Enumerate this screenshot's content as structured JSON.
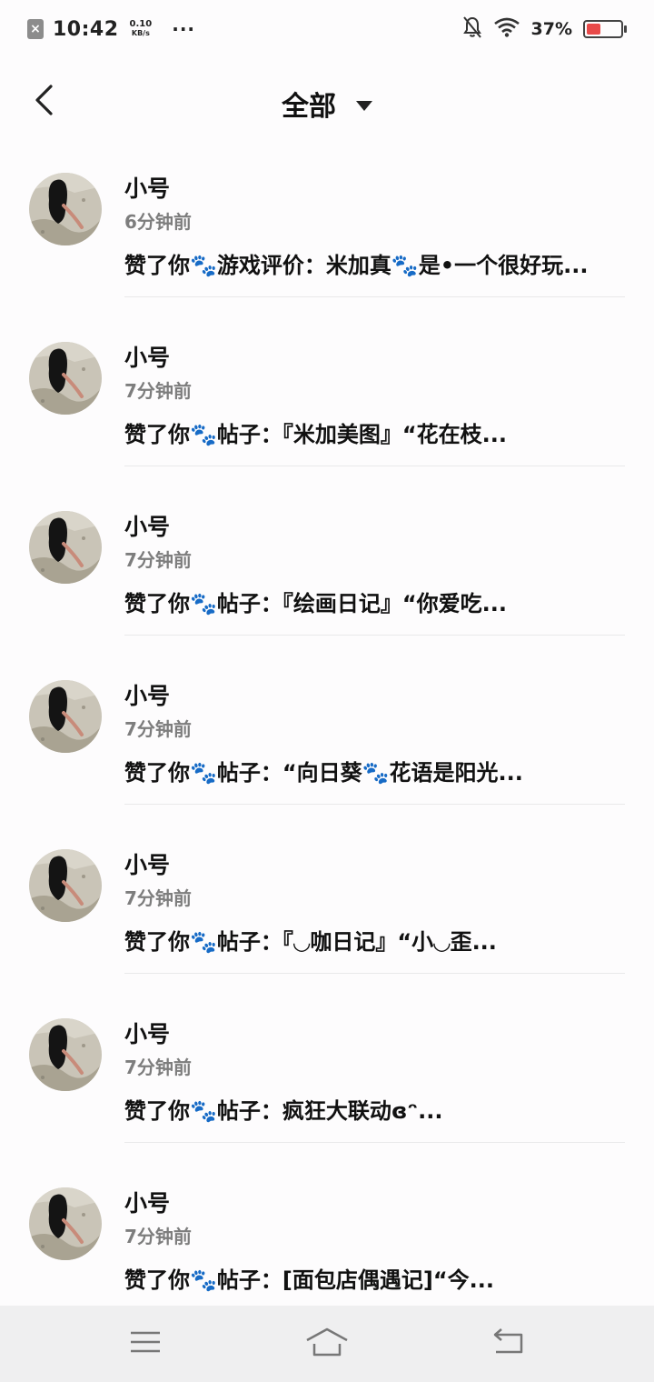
{
  "status_bar": {
    "time": "10:42",
    "speed_value": "0.10",
    "speed_unit": "KB/s",
    "more": "···",
    "battery_text": "37%",
    "battery_level": 0.37,
    "battery_color": "#e84a4a"
  },
  "header": {
    "title": "全部"
  },
  "items": [
    {
      "name": "小号",
      "time": "6分钟前",
      "text": "赞了你🐾游戏评价：米加真🐾是•一个很好玩..."
    },
    {
      "name": "小号",
      "time": "7分钟前",
      "text": "赞了你🐾帖子：『米加美图』“花在枝..."
    },
    {
      "name": "小号",
      "time": "7分钟前",
      "text": "赞了你🐾帖子：『绘画日记』“你爱吃..."
    },
    {
      "name": "小号",
      "time": "7分钟前",
      "text": "赞了你🐾帖子：“向日葵🐾花语是阳光..."
    },
    {
      "name": "小号",
      "time": "7分钟前",
      "text": "赞了你🐾帖子：『◡咖日记』“小◡歪..."
    },
    {
      "name": "小号",
      "time": "7分钟前",
      "text": "赞了你🐾帖子：疯狂大联动ɞᵔ..."
    },
    {
      "name": "小号",
      "time": "7分钟前",
      "text": "赞了你🐾帖子：[面包店偶遇记]“今..."
    }
  ],
  "icons": {
    "back": "chevron-left-icon",
    "dropdown": "caret-down-icon",
    "menu": "menu-icon",
    "home": "home-icon",
    "return": "return-icon"
  }
}
